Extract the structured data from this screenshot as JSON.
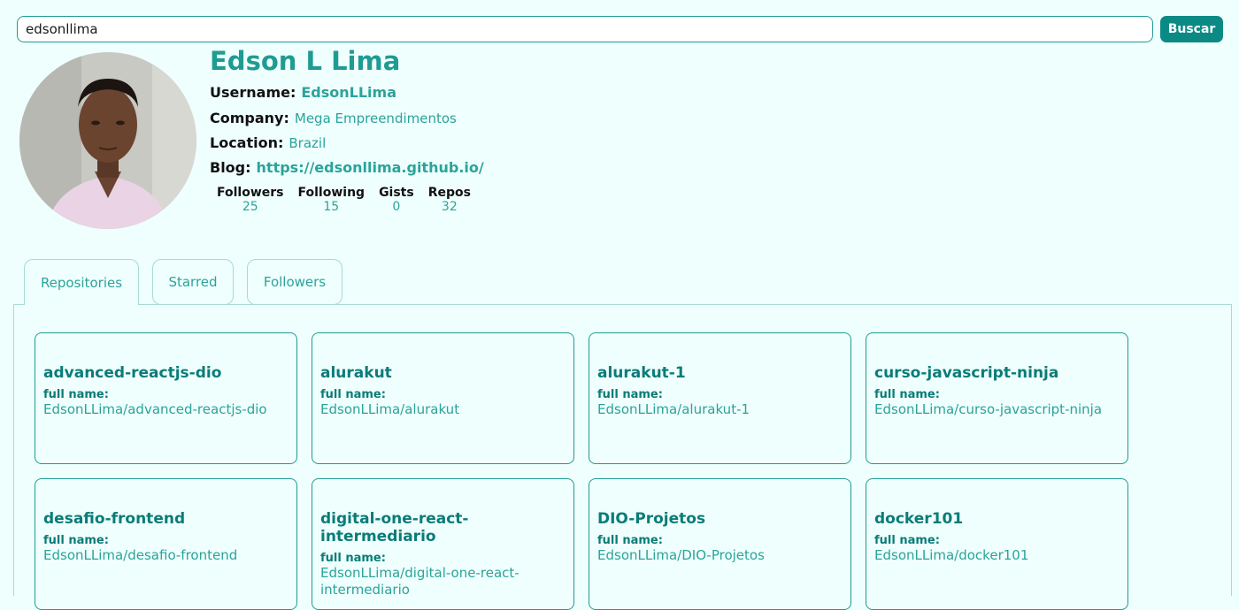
{
  "search": {
    "value": "edsonllima",
    "button_label": "Buscar"
  },
  "profile": {
    "name": "Edson L Lima",
    "username_label": "Username:",
    "username": "EdsonLLima",
    "company_label": "Company:",
    "company": "Mega Empreendimentos",
    "location_label": "Location:",
    "location": "Brazil",
    "blog_label": "Blog:",
    "blog": "https://edsonllima.github.io/",
    "stats": [
      {
        "label": "Followers",
        "value": "25"
      },
      {
        "label": "Following",
        "value": "15"
      },
      {
        "label": "Gists",
        "value": "0"
      },
      {
        "label": "Repos",
        "value": "32"
      }
    ]
  },
  "tabs": [
    {
      "label": "Repositories",
      "active": true
    },
    {
      "label": "Starred",
      "active": false
    },
    {
      "label": "Followers",
      "active": false
    }
  ],
  "repos": [
    {
      "name": "advanced-reactjs-dio",
      "full_name_label": "full name:",
      "full_name": "EdsonLLima/advanced-reactjs-dio"
    },
    {
      "name": "alurakut",
      "full_name_label": "full name:",
      "full_name": "EdsonLLima/alurakut"
    },
    {
      "name": "alurakut-1",
      "full_name_label": "full name:",
      "full_name": "EdsonLLima/alurakut-1"
    },
    {
      "name": "curso-javascript-ninja",
      "full_name_label": "full name:",
      "full_name": "EdsonLLima/curso-javascript-ninja"
    },
    {
      "name": "desafio-frontend",
      "full_name_label": "full name:",
      "full_name": "EdsonLLima/desafio-frontend"
    },
    {
      "name": "digital-one-react-intermediario",
      "full_name_label": "full name:",
      "full_name": "EdsonLLima/digital-one-react-intermediario"
    },
    {
      "name": "DIO-Projetos",
      "full_name_label": "full name:",
      "full_name": "EdsonLLima/DIO-Projetos"
    },
    {
      "name": "docker101",
      "full_name_label": "full name:",
      "full_name": "EdsonLLima/docker101"
    }
  ],
  "colors": {
    "accent": "#1f9b93",
    "button": "#0b8a85",
    "background": "#effffd"
  }
}
